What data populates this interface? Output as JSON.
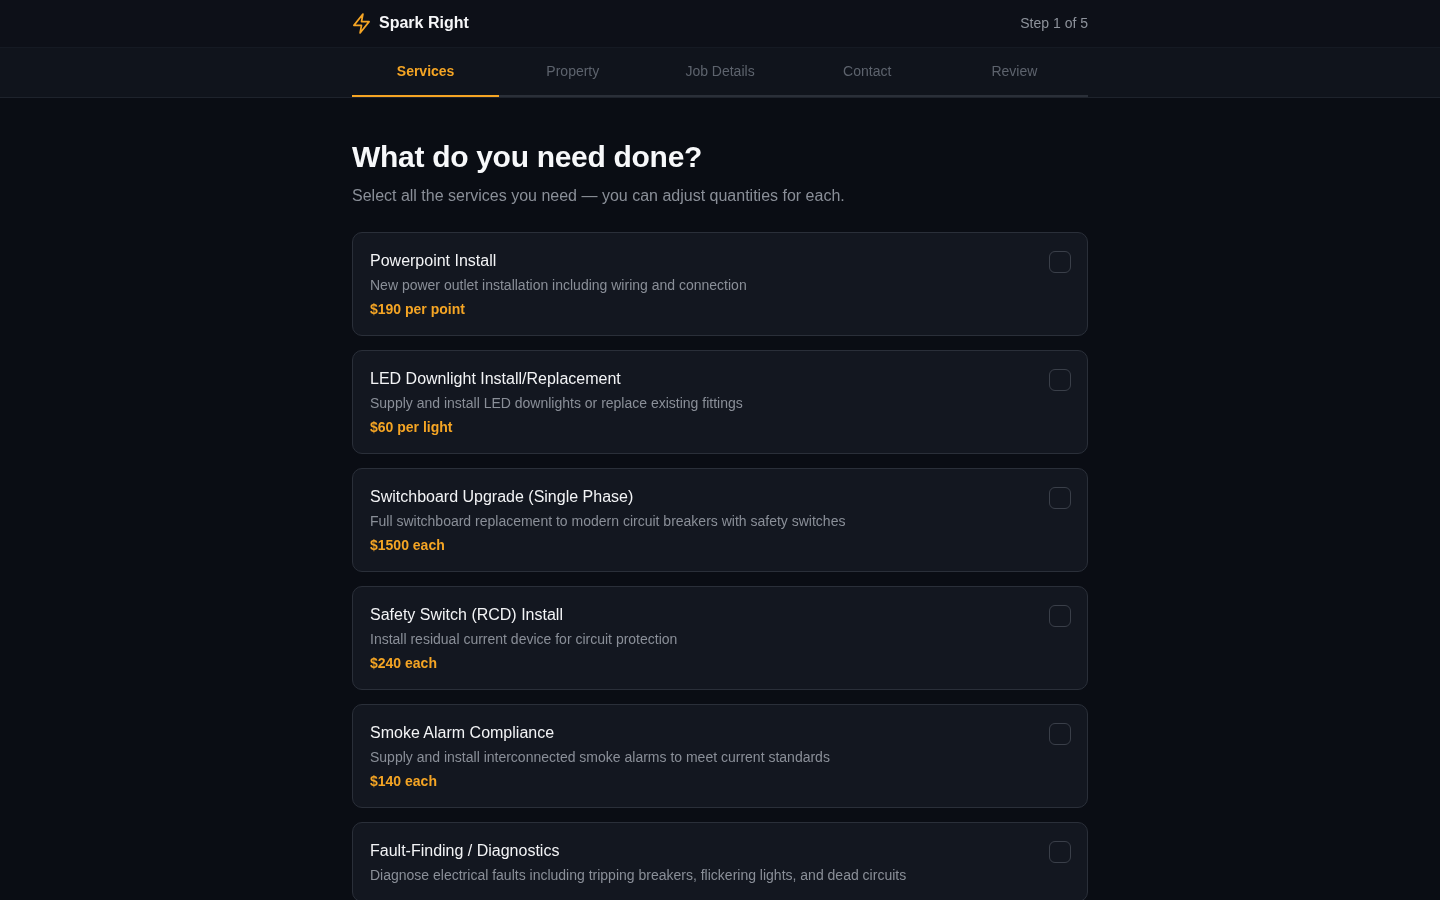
{
  "header": {
    "brand": "Spark Right",
    "step": "Step 1 of 5"
  },
  "tabs": [
    {
      "label": "Services",
      "selected": true
    },
    {
      "label": "Property",
      "selected": false
    },
    {
      "label": "Job Details",
      "selected": false
    },
    {
      "label": "Contact",
      "selected": false
    },
    {
      "label": "Review",
      "selected": false
    }
  ],
  "page": {
    "title": "What do you need done?",
    "subtitle": "Select all the services you need — you can adjust quantities for each."
  },
  "services": [
    {
      "name": "Powerpoint Install",
      "description": "New power outlet installation including wiring and connection",
      "price": "$190 per point",
      "checked": false
    },
    {
      "name": "LED Downlight Install/Replacement",
      "description": "Supply and install LED downlights or replace existing fittings",
      "price": "$60 per light",
      "checked": false
    },
    {
      "name": "Switchboard Upgrade (Single Phase)",
      "description": "Full switchboard replacement to modern circuit breakers with safety switches",
      "price": "$1500 each",
      "checked": false
    },
    {
      "name": "Safety Switch (RCD) Install",
      "description": "Install residual current device for circuit protection",
      "price": "$240 each",
      "checked": false
    },
    {
      "name": "Smoke Alarm Compliance",
      "description": "Supply and install interconnected smoke alarms to meet current standards",
      "price": "$140 each",
      "checked": false
    },
    {
      "name": "Fault-Finding / Diagnostics",
      "description": "Diagnose electrical faults including tripping breakers, flickering lights, and dead circuits",
      "checked": false
    }
  ]
}
